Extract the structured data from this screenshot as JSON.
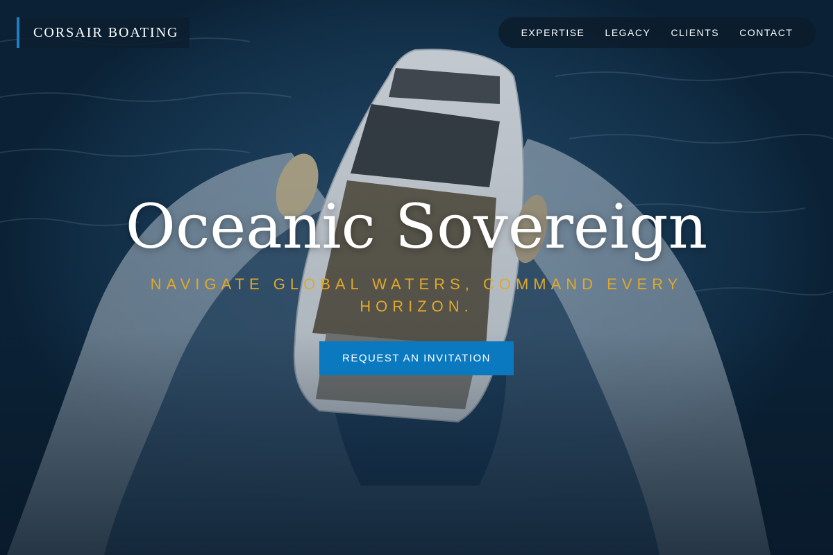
{
  "brand": {
    "name": "CORSAIR BOATING"
  },
  "nav": {
    "items": [
      "EXPERTISE",
      "LEGACY",
      "CLIENTS",
      "CONTACT"
    ]
  },
  "hero": {
    "title": "Oceanic Sovereign",
    "subtitle": "NAVIGATE GLOBAL WATERS, COMMAND EVERY HORIZON.",
    "cta_label": "REQUEST AN INVITATION"
  },
  "colors": {
    "accent": "#1e7fc8",
    "cta": "#0b79c0",
    "subtitle": "#e0a82a",
    "water": "#1e4260"
  }
}
